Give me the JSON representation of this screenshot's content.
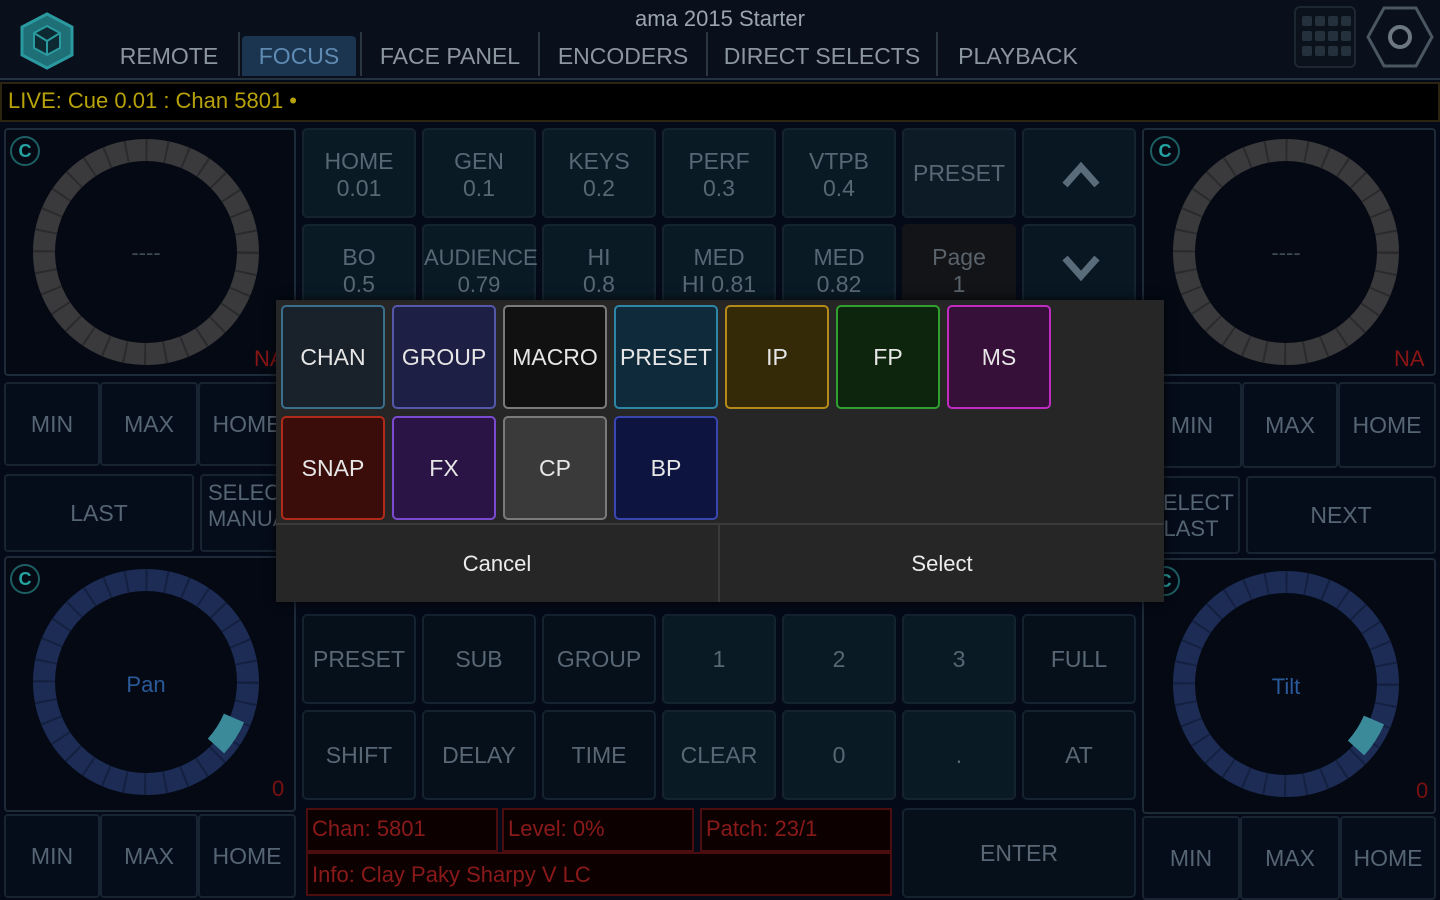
{
  "app": {
    "title": "ama 2015 Starter"
  },
  "tabs": [
    {
      "label": "REMOTE",
      "active": false
    },
    {
      "label": "FOCUS",
      "active": true
    },
    {
      "label": "FACE PANEL",
      "active": false
    },
    {
      "label": "ENCODERS",
      "active": false
    },
    {
      "label": "DIRECT SELECTS",
      "active": false
    },
    {
      "label": "PLAYBACK",
      "active": false
    }
  ],
  "status": {
    "live": "LIVE: Cue  0.01 : Chan 5801 •"
  },
  "encoders": {
    "badge": "C",
    "top_left": {
      "label": "----",
      "value": "NA"
    },
    "top_right": {
      "label": "----",
      "value": "NA"
    },
    "bottom_left": {
      "label": "Pan",
      "value": "0"
    },
    "bottom_right": {
      "label": "Tilt",
      "value": "0"
    }
  },
  "side_buttons": {
    "min": "MIN",
    "max": "MAX",
    "home": "HOME",
    "last": "LAST",
    "next": "NEXT",
    "select_manual": "SELECT MANUAL",
    "select_last": "SELECT LAST"
  },
  "keypad": {
    "row1": [
      {
        "top": "HOME",
        "bottom": "0.01"
      },
      {
        "top": "GEN",
        "bottom": "0.1"
      },
      {
        "top": "KEYS",
        "bottom": "0.2"
      },
      {
        "top": "PERF",
        "bottom": "0.3"
      },
      {
        "top": "VTPB",
        "bottom": "0.4"
      },
      {
        "top": "PRESET",
        "bottom": ""
      }
    ],
    "row2": [
      {
        "top": "BO",
        "bottom": "0.5"
      },
      {
        "top": "AUDIENCE",
        "bottom": "0.79"
      },
      {
        "top": "HI",
        "bottom": "0.8"
      },
      {
        "top": "MED",
        "bottom": "HI 0.81"
      },
      {
        "top": "MED",
        "bottom": "0.82"
      },
      {
        "top": "Page",
        "bottom": "1"
      }
    ],
    "row3": [
      "PRESET",
      "SUB",
      "GROUP",
      "1",
      "2",
      "3",
      "FULL"
    ],
    "row4": [
      "SHIFT",
      "DELAY",
      "TIME",
      "CLEAR",
      "0",
      ".",
      "AT"
    ],
    "enter": "ENTER"
  },
  "info": {
    "chan": "Chan: 5801",
    "level": "Level: 0%",
    "patch": "Patch: 23/1",
    "fixture": "Info: Clay Paky Sharpy V LC"
  },
  "dialog": {
    "buttons": [
      {
        "label": "CHAN",
        "color": "#3a6e8c",
        "bg": "#19212a"
      },
      {
        "label": "GROUP",
        "color": "#5557a8",
        "bg": "#1e1f44"
      },
      {
        "label": "MACRO",
        "color": "#7a7a7a",
        "bg": "#111111"
      },
      {
        "label": "PRESET",
        "color": "#2e86a6",
        "bg": "#0f2a3a"
      },
      {
        "label": "IP",
        "color": "#b38a1a",
        "bg": "#342a08"
      },
      {
        "label": "FP",
        "color": "#2fa02f",
        "bg": "#0d240d"
      },
      {
        "label": "MS",
        "color": "#c02bc2",
        "bg": "#361038"
      },
      {
        "label": "SNAP",
        "color": "#b02a1a",
        "bg": "#3a0d0a"
      },
      {
        "label": "FX",
        "color": "#7a4bd0",
        "bg": "#2a1445"
      },
      {
        "label": "CP",
        "color": "#7a7a7a",
        "bg": "#3a3a3a"
      },
      {
        "label": "BP",
        "color": "#3a46b0",
        "bg": "#0e1440"
      }
    ],
    "cancel": "Cancel",
    "select": "Select"
  }
}
